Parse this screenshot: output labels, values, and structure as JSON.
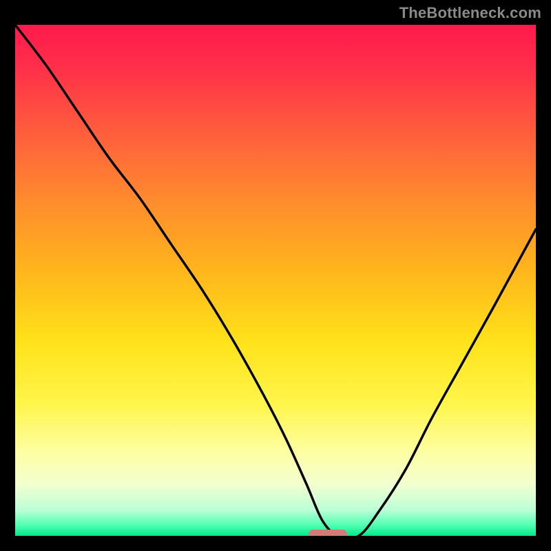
{
  "watermark": "TheBottleneck.com",
  "chart_data": {
    "type": "line",
    "title": "",
    "xlabel": "",
    "ylabel": "",
    "xlim": [
      0,
      100
    ],
    "ylim": [
      0,
      100
    ],
    "grid": false,
    "legend": false,
    "gradient_stops": [
      {
        "pos": 0,
        "color": "#ff1a4d"
      },
      {
        "pos": 8,
        "color": "#ff2e4a"
      },
      {
        "pos": 20,
        "color": "#ff5a3e"
      },
      {
        "pos": 34,
        "color": "#ff8a2e"
      },
      {
        "pos": 48,
        "color": "#ffb51c"
      },
      {
        "pos": 62,
        "color": "#ffe21a"
      },
      {
        "pos": 74,
        "color": "#fff54a"
      },
      {
        "pos": 84,
        "color": "#fdffa6"
      },
      {
        "pos": 90,
        "color": "#f2ffd0"
      },
      {
        "pos": 95,
        "color": "#baffd6"
      },
      {
        "pos": 98,
        "color": "#4dffb0"
      },
      {
        "pos": 100,
        "color": "#00e889"
      }
    ],
    "series": [
      {
        "name": "bottleneck-curve",
        "x": [
          0,
          6,
          12,
          18,
          24,
          30,
          36,
          42,
          48,
          52,
          56,
          59,
          62,
          66,
          70,
          75,
          80,
          86,
          92,
          100
        ],
        "y": [
          100,
          92,
          83,
          74,
          66,
          57,
          48,
          38,
          27,
          19,
          10,
          3,
          0,
          0,
          5,
          13,
          23,
          34,
          45,
          60
        ]
      }
    ],
    "marker": {
      "x": 60,
      "y": 0,
      "color": "#d67a78"
    }
  }
}
